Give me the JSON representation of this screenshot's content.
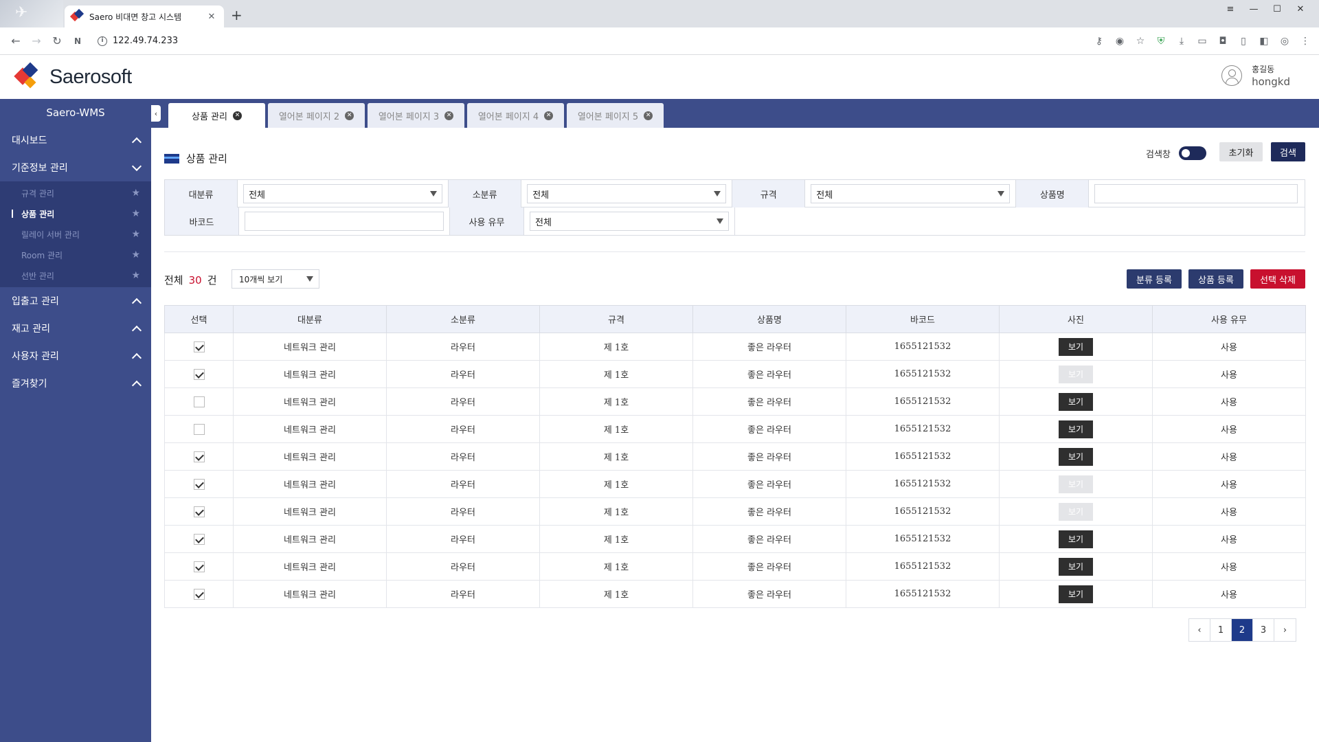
{
  "browser": {
    "tab_title": "Saero 비대면 창고 시스템",
    "url": "122.49.74.233"
  },
  "header": {
    "logo_text": "Saerosoft",
    "user_name": "홍길동",
    "user_id": "hongkd"
  },
  "sidebar": {
    "brand": "Saero-WMS",
    "menu": [
      {
        "label": "대시보드"
      },
      {
        "label": "기준정보 관리"
      },
      {
        "label": "입출고 관리"
      },
      {
        "label": "재고 관리"
      },
      {
        "label": "사용자 관리"
      },
      {
        "label": "즐겨찾기"
      }
    ],
    "submenu": [
      {
        "label": "규격 관리"
      },
      {
        "label": "상품 관리"
      },
      {
        "label": "릴레이 서버 관리"
      },
      {
        "label": "Room 관리"
      },
      {
        "label": "선반 관리"
      }
    ]
  },
  "page_tabs": [
    {
      "label": "상품 관리"
    },
    {
      "label": "열어본 페이지 2"
    },
    {
      "label": "열어본 페이지 3"
    },
    {
      "label": "열어본 페이지 4"
    },
    {
      "label": "열어본 페이지 5"
    }
  ],
  "page": {
    "title": "상품 관리",
    "search_toggle_label": "검색창",
    "reset_label": "초기화",
    "search_label": "검색"
  },
  "filter": {
    "category_label": "대분류",
    "category_value": "전체",
    "subcategory_label": "소분류",
    "subcategory_value": "전체",
    "spec_label": "규격",
    "spec_value": "전체",
    "product_name_label": "상품명",
    "barcode_label": "바코드",
    "usage_label": "사용 유무",
    "usage_value": "전체"
  },
  "toolbar": {
    "total_label": "전체",
    "total_count": "30",
    "total_unit": "건",
    "page_size": "10개씩 보기",
    "add_category_label": "분류 등록",
    "add_product_label": "상품 등록",
    "delete_selected_label": "선택 삭제"
  },
  "table": {
    "headers": [
      "선택",
      "대분류",
      "소분류",
      "규격",
      "상품명",
      "바코드",
      "사진",
      "사용 유무"
    ],
    "view_label": "보기",
    "rows": [
      {
        "checked": true,
        "category": "네트워크 관리",
        "subcategory": "라우터",
        "spec": "제 1호",
        "name": "좋은 라우터",
        "barcode": "1655121532",
        "photo": true,
        "usage": "사용"
      },
      {
        "checked": true,
        "category": "네트워크 관리",
        "subcategory": "라우터",
        "spec": "제 1호",
        "name": "좋은 라우터",
        "barcode": "1655121532",
        "photo": false,
        "usage": "사용"
      },
      {
        "checked": false,
        "category": "네트워크 관리",
        "subcategory": "라우터",
        "spec": "제 1호",
        "name": "좋은 라우터",
        "barcode": "1655121532",
        "photo": true,
        "usage": "사용"
      },
      {
        "checked": false,
        "category": "네트워크 관리",
        "subcategory": "라우터",
        "spec": "제 1호",
        "name": "좋은 라우터",
        "barcode": "1655121532",
        "photo": true,
        "usage": "사용"
      },
      {
        "checked": true,
        "category": "네트워크 관리",
        "subcategory": "라우터",
        "spec": "제 1호",
        "name": "좋은 라우터",
        "barcode": "1655121532",
        "photo": true,
        "usage": "사용"
      },
      {
        "checked": true,
        "category": "네트워크 관리",
        "subcategory": "라우터",
        "spec": "제 1호",
        "name": "좋은 라우터",
        "barcode": "1655121532",
        "photo": false,
        "usage": "사용"
      },
      {
        "checked": true,
        "category": "네트워크 관리",
        "subcategory": "라우터",
        "spec": "제 1호",
        "name": "좋은 라우터",
        "barcode": "1655121532",
        "photo": false,
        "usage": "사용"
      },
      {
        "checked": true,
        "category": "네트워크 관리",
        "subcategory": "라우터",
        "spec": "제 1호",
        "name": "좋은 라우터",
        "barcode": "1655121532",
        "photo": true,
        "usage": "사용"
      },
      {
        "checked": true,
        "category": "네트워크 관리",
        "subcategory": "라우터",
        "spec": "제 1호",
        "name": "좋은 라우터",
        "barcode": "1655121532",
        "photo": true,
        "usage": "사용"
      },
      {
        "checked": true,
        "category": "네트워크 관리",
        "subcategory": "라우터",
        "spec": "제 1호",
        "name": "좋은 라우터",
        "barcode": "1655121532",
        "photo": true,
        "usage": "사용"
      }
    ]
  },
  "pagination": {
    "prev": "‹",
    "pages": [
      "1",
      "2",
      "3"
    ],
    "current": "2",
    "next": "›"
  },
  "colors": {
    "sidebar": "#3d4d8a",
    "primary": "#2c3b6e",
    "danger": "#c8102e"
  }
}
